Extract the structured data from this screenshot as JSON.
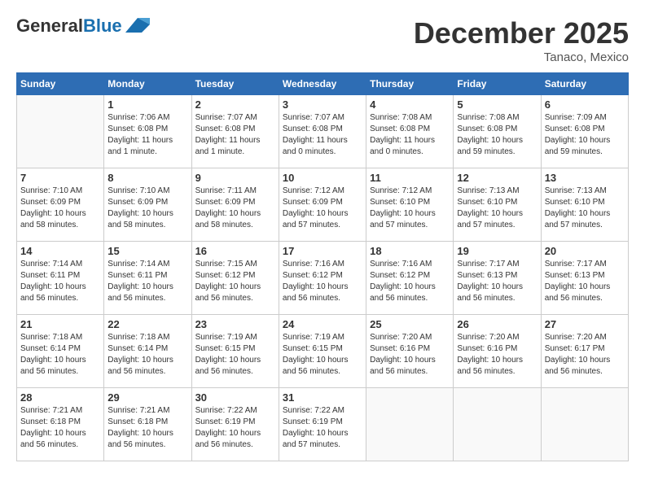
{
  "header": {
    "logo_line1": "General",
    "logo_line2": "Blue",
    "month": "December 2025",
    "location": "Tanaco, Mexico"
  },
  "weekdays": [
    "Sunday",
    "Monday",
    "Tuesday",
    "Wednesday",
    "Thursday",
    "Friday",
    "Saturday"
  ],
  "weeks": [
    [
      {
        "day": "",
        "info": ""
      },
      {
        "day": "1",
        "info": "Sunrise: 7:06 AM\nSunset: 6:08 PM\nDaylight: 11 hours\nand 1 minute."
      },
      {
        "day": "2",
        "info": "Sunrise: 7:07 AM\nSunset: 6:08 PM\nDaylight: 11 hours\nand 1 minute."
      },
      {
        "day": "3",
        "info": "Sunrise: 7:07 AM\nSunset: 6:08 PM\nDaylight: 11 hours\nand 0 minutes."
      },
      {
        "day": "4",
        "info": "Sunrise: 7:08 AM\nSunset: 6:08 PM\nDaylight: 11 hours\nand 0 minutes."
      },
      {
        "day": "5",
        "info": "Sunrise: 7:08 AM\nSunset: 6:08 PM\nDaylight: 10 hours\nand 59 minutes."
      },
      {
        "day": "6",
        "info": "Sunrise: 7:09 AM\nSunset: 6:08 PM\nDaylight: 10 hours\nand 59 minutes."
      }
    ],
    [
      {
        "day": "7",
        "info": "Sunrise: 7:10 AM\nSunset: 6:09 PM\nDaylight: 10 hours\nand 58 minutes."
      },
      {
        "day": "8",
        "info": "Sunrise: 7:10 AM\nSunset: 6:09 PM\nDaylight: 10 hours\nand 58 minutes."
      },
      {
        "day": "9",
        "info": "Sunrise: 7:11 AM\nSunset: 6:09 PM\nDaylight: 10 hours\nand 58 minutes."
      },
      {
        "day": "10",
        "info": "Sunrise: 7:12 AM\nSunset: 6:09 PM\nDaylight: 10 hours\nand 57 minutes."
      },
      {
        "day": "11",
        "info": "Sunrise: 7:12 AM\nSunset: 6:10 PM\nDaylight: 10 hours\nand 57 minutes."
      },
      {
        "day": "12",
        "info": "Sunrise: 7:13 AM\nSunset: 6:10 PM\nDaylight: 10 hours\nand 57 minutes."
      },
      {
        "day": "13",
        "info": "Sunrise: 7:13 AM\nSunset: 6:10 PM\nDaylight: 10 hours\nand 57 minutes."
      }
    ],
    [
      {
        "day": "14",
        "info": "Sunrise: 7:14 AM\nSunset: 6:11 PM\nDaylight: 10 hours\nand 56 minutes."
      },
      {
        "day": "15",
        "info": "Sunrise: 7:14 AM\nSunset: 6:11 PM\nDaylight: 10 hours\nand 56 minutes."
      },
      {
        "day": "16",
        "info": "Sunrise: 7:15 AM\nSunset: 6:12 PM\nDaylight: 10 hours\nand 56 minutes."
      },
      {
        "day": "17",
        "info": "Sunrise: 7:16 AM\nSunset: 6:12 PM\nDaylight: 10 hours\nand 56 minutes."
      },
      {
        "day": "18",
        "info": "Sunrise: 7:16 AM\nSunset: 6:12 PM\nDaylight: 10 hours\nand 56 minutes."
      },
      {
        "day": "19",
        "info": "Sunrise: 7:17 AM\nSunset: 6:13 PM\nDaylight: 10 hours\nand 56 minutes."
      },
      {
        "day": "20",
        "info": "Sunrise: 7:17 AM\nSunset: 6:13 PM\nDaylight: 10 hours\nand 56 minutes."
      }
    ],
    [
      {
        "day": "21",
        "info": "Sunrise: 7:18 AM\nSunset: 6:14 PM\nDaylight: 10 hours\nand 56 minutes."
      },
      {
        "day": "22",
        "info": "Sunrise: 7:18 AM\nSunset: 6:14 PM\nDaylight: 10 hours\nand 56 minutes."
      },
      {
        "day": "23",
        "info": "Sunrise: 7:19 AM\nSunset: 6:15 PM\nDaylight: 10 hours\nand 56 minutes."
      },
      {
        "day": "24",
        "info": "Sunrise: 7:19 AM\nSunset: 6:15 PM\nDaylight: 10 hours\nand 56 minutes."
      },
      {
        "day": "25",
        "info": "Sunrise: 7:20 AM\nSunset: 6:16 PM\nDaylight: 10 hours\nand 56 minutes."
      },
      {
        "day": "26",
        "info": "Sunrise: 7:20 AM\nSunset: 6:16 PM\nDaylight: 10 hours\nand 56 minutes."
      },
      {
        "day": "27",
        "info": "Sunrise: 7:20 AM\nSunset: 6:17 PM\nDaylight: 10 hours\nand 56 minutes."
      }
    ],
    [
      {
        "day": "28",
        "info": "Sunrise: 7:21 AM\nSunset: 6:18 PM\nDaylight: 10 hours\nand 56 minutes."
      },
      {
        "day": "29",
        "info": "Sunrise: 7:21 AM\nSunset: 6:18 PM\nDaylight: 10 hours\nand 56 minutes."
      },
      {
        "day": "30",
        "info": "Sunrise: 7:22 AM\nSunset: 6:19 PM\nDaylight: 10 hours\nand 56 minutes."
      },
      {
        "day": "31",
        "info": "Sunrise: 7:22 AM\nSunset: 6:19 PM\nDaylight: 10 hours\nand 57 minutes."
      },
      {
        "day": "",
        "info": ""
      },
      {
        "day": "",
        "info": ""
      },
      {
        "day": "",
        "info": ""
      }
    ]
  ]
}
